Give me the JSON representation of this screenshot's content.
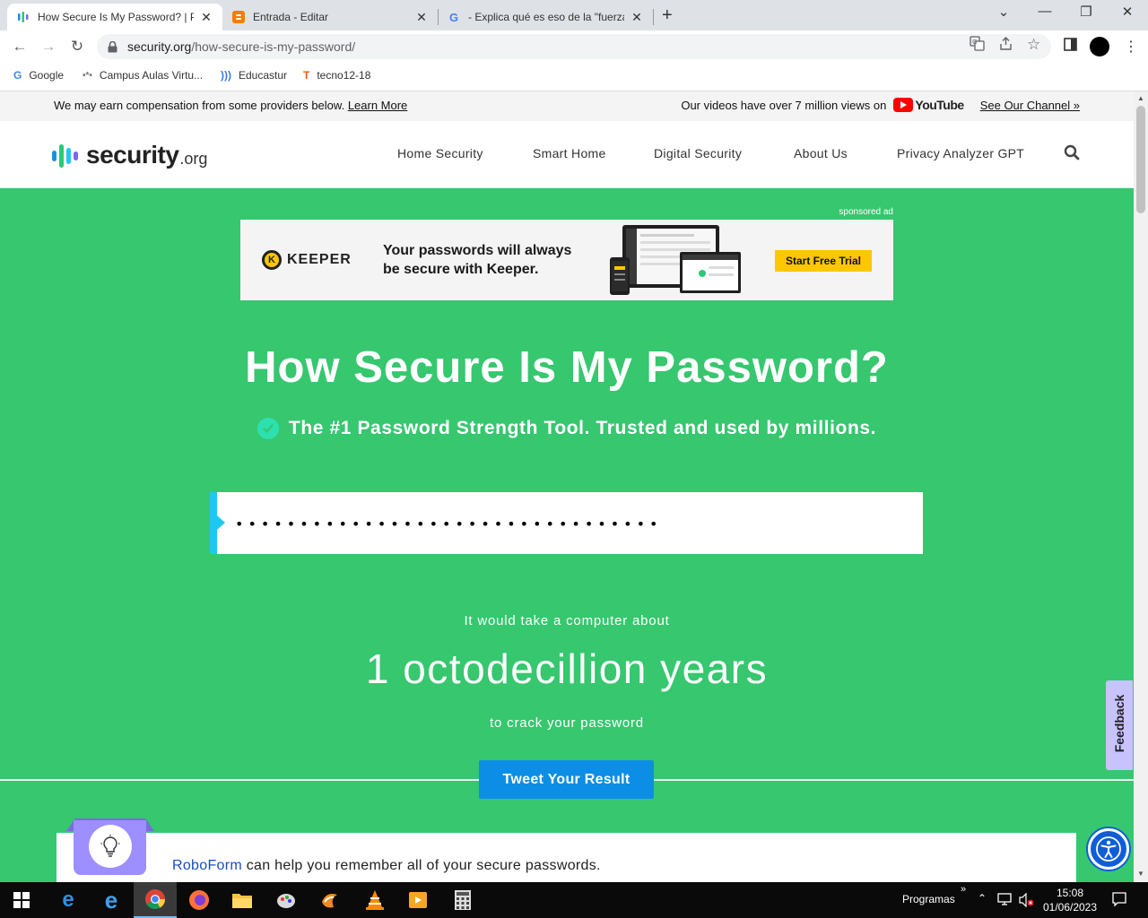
{
  "browser": {
    "tabs": [
      {
        "title": "How Secure Is My Password? | Pa",
        "favicon": "security-org-favicon",
        "active": true
      },
      {
        "title": "Entrada - Editar",
        "favicon": "blogger-favicon",
        "active": false
      },
      {
        "title": "- Explica qué es eso de la \"fuerza",
        "favicon": "google-favicon",
        "active": false
      }
    ],
    "url_domain": "security.org",
    "url_path": "/how-secure-is-my-password/",
    "bookmarks": [
      {
        "label": "Google",
        "icon": "google-icon"
      },
      {
        "label": "Campus Aulas Virtu...",
        "icon": "campus-icon"
      },
      {
        "label": "Educastur",
        "icon": "educastur-icon"
      },
      {
        "label": "tecno12-18",
        "icon": "tecno-icon"
      }
    ]
  },
  "page": {
    "top_strip": {
      "disclosure": "We may earn compensation from some providers below.",
      "learn_more": "Learn More",
      "videos_text": "Our videos have over 7 million views on",
      "youtube_word": "YouTube",
      "channel_link": "See Our Channel »"
    },
    "logo": {
      "word": "security",
      "tld": ".org"
    },
    "nav": [
      "Home Security",
      "Smart Home",
      "Digital Security",
      "About Us",
      "Privacy Analyzer GPT"
    ],
    "ad": {
      "sponsored_label": "sponsored ad",
      "brand": "KEEPER",
      "headline_1": "Your passwords will always",
      "headline_2": "be secure with Keeper.",
      "cta": "Start Free Trial"
    },
    "hero": {
      "title": "How Secure Is My Password?",
      "subtitle": "The #1 Password Strength Tool. Trusted and used by millions."
    },
    "password_field": {
      "value": "•••••••••••••••••••••••••••••••••"
    },
    "result": {
      "pre": "It would take a computer about",
      "time": "1 octodecillion years",
      "post": "to crack your password"
    },
    "tweet_button": "Tweet Your Result",
    "roboform": {
      "link": "RoboForm",
      "text": " can help you remember all of your secure passwords."
    },
    "feedback_tab": "Feedback"
  },
  "taskbar": {
    "apps": [
      "start-icon",
      "edge-icon",
      "internet-explorer-icon",
      "chrome-icon",
      "firefox-icon",
      "file-explorer-icon",
      "paint-icon",
      "scratch-icon",
      "vlc-icon",
      "media-player-icon",
      "calculator-icon"
    ],
    "programs_label": "Programas",
    "time": "15:08",
    "date": "01/06/2023"
  },
  "colors": {
    "page_green": "#36c76f",
    "accent_cyan": "#1ec9f0",
    "tweet_blue": "#0c8ee6",
    "keeper_yellow": "#ffc700"
  }
}
